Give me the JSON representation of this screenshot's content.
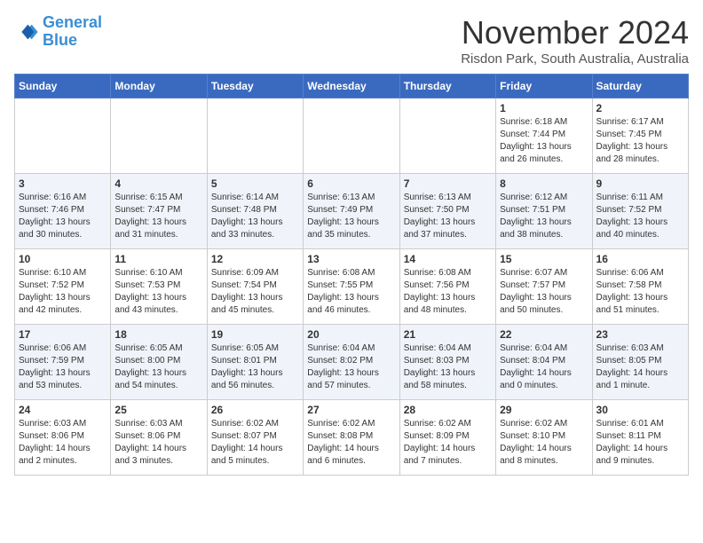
{
  "header": {
    "logo_line1": "General",
    "logo_line2": "Blue",
    "month_title": "November 2024",
    "location": "Risdon Park, South Australia, Australia"
  },
  "days_of_week": [
    "Sunday",
    "Monday",
    "Tuesday",
    "Wednesday",
    "Thursday",
    "Friday",
    "Saturday"
  ],
  "weeks": [
    [
      {
        "day": "",
        "info": ""
      },
      {
        "day": "",
        "info": ""
      },
      {
        "day": "",
        "info": ""
      },
      {
        "day": "",
        "info": ""
      },
      {
        "day": "",
        "info": ""
      },
      {
        "day": "1",
        "info": "Sunrise: 6:18 AM\nSunset: 7:44 PM\nDaylight: 13 hours\nand 26 minutes."
      },
      {
        "day": "2",
        "info": "Sunrise: 6:17 AM\nSunset: 7:45 PM\nDaylight: 13 hours\nand 28 minutes."
      }
    ],
    [
      {
        "day": "3",
        "info": "Sunrise: 6:16 AM\nSunset: 7:46 PM\nDaylight: 13 hours\nand 30 minutes."
      },
      {
        "day": "4",
        "info": "Sunrise: 6:15 AM\nSunset: 7:47 PM\nDaylight: 13 hours\nand 31 minutes."
      },
      {
        "day": "5",
        "info": "Sunrise: 6:14 AM\nSunset: 7:48 PM\nDaylight: 13 hours\nand 33 minutes."
      },
      {
        "day": "6",
        "info": "Sunrise: 6:13 AM\nSunset: 7:49 PM\nDaylight: 13 hours\nand 35 minutes."
      },
      {
        "day": "7",
        "info": "Sunrise: 6:13 AM\nSunset: 7:50 PM\nDaylight: 13 hours\nand 37 minutes."
      },
      {
        "day": "8",
        "info": "Sunrise: 6:12 AM\nSunset: 7:51 PM\nDaylight: 13 hours\nand 38 minutes."
      },
      {
        "day": "9",
        "info": "Sunrise: 6:11 AM\nSunset: 7:52 PM\nDaylight: 13 hours\nand 40 minutes."
      }
    ],
    [
      {
        "day": "10",
        "info": "Sunrise: 6:10 AM\nSunset: 7:52 PM\nDaylight: 13 hours\nand 42 minutes."
      },
      {
        "day": "11",
        "info": "Sunrise: 6:10 AM\nSunset: 7:53 PM\nDaylight: 13 hours\nand 43 minutes."
      },
      {
        "day": "12",
        "info": "Sunrise: 6:09 AM\nSunset: 7:54 PM\nDaylight: 13 hours\nand 45 minutes."
      },
      {
        "day": "13",
        "info": "Sunrise: 6:08 AM\nSunset: 7:55 PM\nDaylight: 13 hours\nand 46 minutes."
      },
      {
        "day": "14",
        "info": "Sunrise: 6:08 AM\nSunset: 7:56 PM\nDaylight: 13 hours\nand 48 minutes."
      },
      {
        "day": "15",
        "info": "Sunrise: 6:07 AM\nSunset: 7:57 PM\nDaylight: 13 hours\nand 50 minutes."
      },
      {
        "day": "16",
        "info": "Sunrise: 6:06 AM\nSunset: 7:58 PM\nDaylight: 13 hours\nand 51 minutes."
      }
    ],
    [
      {
        "day": "17",
        "info": "Sunrise: 6:06 AM\nSunset: 7:59 PM\nDaylight: 13 hours\nand 53 minutes."
      },
      {
        "day": "18",
        "info": "Sunrise: 6:05 AM\nSunset: 8:00 PM\nDaylight: 13 hours\nand 54 minutes."
      },
      {
        "day": "19",
        "info": "Sunrise: 6:05 AM\nSunset: 8:01 PM\nDaylight: 13 hours\nand 56 minutes."
      },
      {
        "day": "20",
        "info": "Sunrise: 6:04 AM\nSunset: 8:02 PM\nDaylight: 13 hours\nand 57 minutes."
      },
      {
        "day": "21",
        "info": "Sunrise: 6:04 AM\nSunset: 8:03 PM\nDaylight: 13 hours\nand 58 minutes."
      },
      {
        "day": "22",
        "info": "Sunrise: 6:04 AM\nSunset: 8:04 PM\nDaylight: 14 hours\nand 0 minutes."
      },
      {
        "day": "23",
        "info": "Sunrise: 6:03 AM\nSunset: 8:05 PM\nDaylight: 14 hours\nand 1 minute."
      }
    ],
    [
      {
        "day": "24",
        "info": "Sunrise: 6:03 AM\nSunset: 8:06 PM\nDaylight: 14 hours\nand 2 minutes."
      },
      {
        "day": "25",
        "info": "Sunrise: 6:03 AM\nSunset: 8:06 PM\nDaylight: 14 hours\nand 3 minutes."
      },
      {
        "day": "26",
        "info": "Sunrise: 6:02 AM\nSunset: 8:07 PM\nDaylight: 14 hours\nand 5 minutes."
      },
      {
        "day": "27",
        "info": "Sunrise: 6:02 AM\nSunset: 8:08 PM\nDaylight: 14 hours\nand 6 minutes."
      },
      {
        "day": "28",
        "info": "Sunrise: 6:02 AM\nSunset: 8:09 PM\nDaylight: 14 hours\nand 7 minutes."
      },
      {
        "day": "29",
        "info": "Sunrise: 6:02 AM\nSunset: 8:10 PM\nDaylight: 14 hours\nand 8 minutes."
      },
      {
        "day": "30",
        "info": "Sunrise: 6:01 AM\nSunset: 8:11 PM\nDaylight: 14 hours\nand 9 minutes."
      }
    ]
  ]
}
